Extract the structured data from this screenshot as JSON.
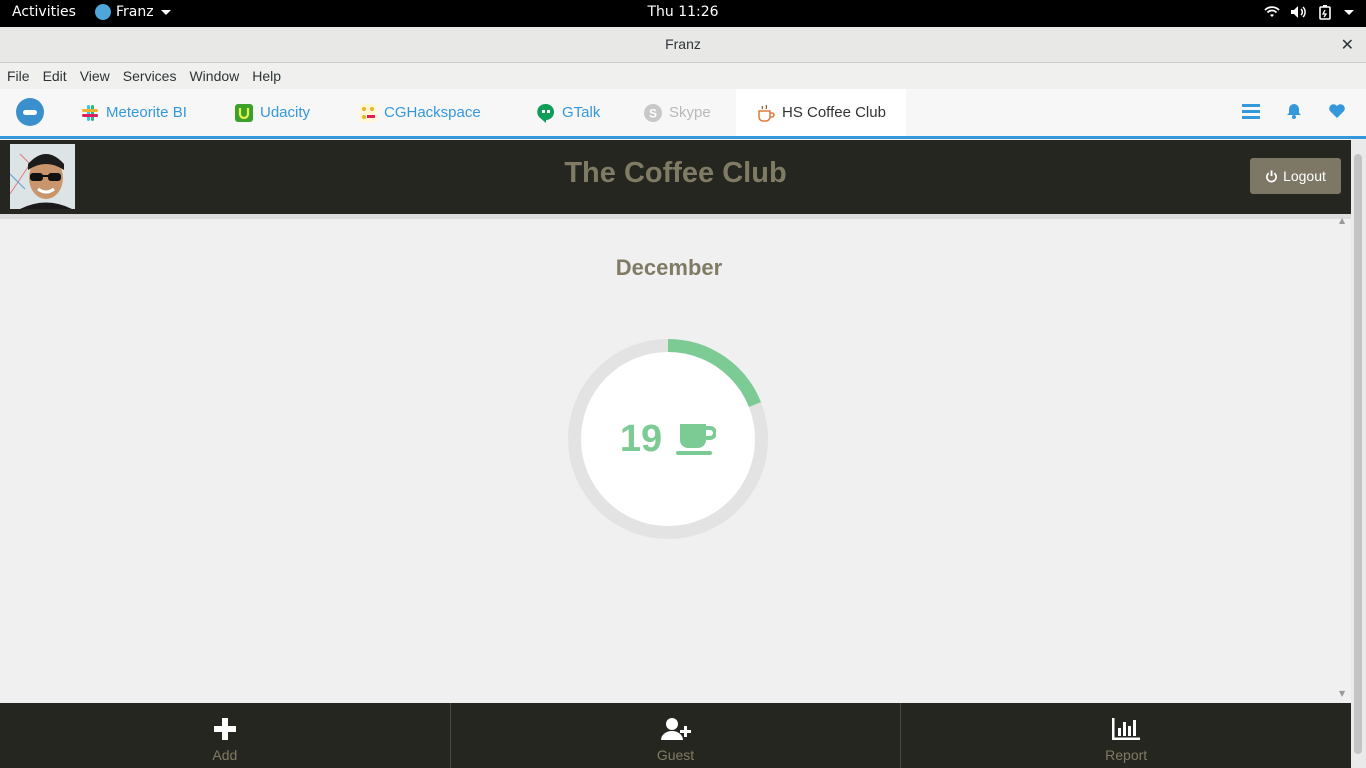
{
  "topbar": {
    "activities": "Activities",
    "app_name": "Franz",
    "clock": "Thu 11:26"
  },
  "window": {
    "title": "Franz",
    "close_glyph": "✕"
  },
  "menu": [
    "File",
    "Edit",
    "View",
    "Services",
    "Window",
    "Help"
  ],
  "tabs": [
    {
      "label": "Meteorite BI",
      "icon": "slack-icon",
      "color": "#e01e5a"
    },
    {
      "label": "Udacity",
      "icon": "udacity-icon",
      "color": "#02b3e4"
    },
    {
      "label": "CGHackspace",
      "icon": "slack-icon",
      "color": "#ecb22e"
    },
    {
      "label": "GTalk",
      "icon": "hangouts-icon",
      "color": "#0f9d58"
    },
    {
      "label": "Skype",
      "icon": "skype-icon",
      "color": "#b8b8b8"
    },
    {
      "label": "HS Coffee Club",
      "icon": "coffee-cup-icon",
      "color": "#e07a3a"
    }
  ],
  "header": {
    "title": "The Coffee Club",
    "logout": "Logout"
  },
  "main": {
    "month": "December",
    "count": "19",
    "progress_fraction": 0.19
  },
  "actions": [
    {
      "label": "Add",
      "icon": "plus-icon"
    },
    {
      "label": "Guest",
      "icon": "add-user-icon"
    },
    {
      "label": "Report",
      "icon": "bar-chart-icon"
    }
  ],
  "colors": {
    "accent": "#3498db",
    "header_bg": "#262620",
    "header_text": "#807b64",
    "gauge": "#7dcb94",
    "gauge_track": "#e3e3e3"
  }
}
